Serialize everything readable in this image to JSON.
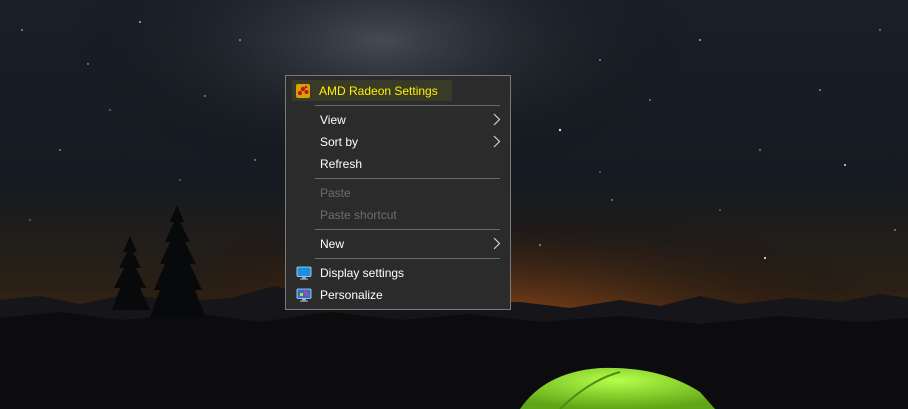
{
  "desktop": {
    "wallpaper": "night-sky-with-tent",
    "colors": {
      "sky_top": "#141922",
      "horizon": "#8a4a16",
      "tent": "#7fd12a"
    }
  },
  "context_menu": {
    "items": [
      {
        "id": "amd",
        "label": "AMD Radeon Settings",
        "icon": "amd-radeon-icon",
        "highlight": true
      },
      {
        "id": "view",
        "label": "View",
        "submenu": true
      },
      {
        "id": "sortby",
        "label": "Sort by",
        "submenu": true
      },
      {
        "id": "refresh",
        "label": "Refresh"
      },
      {
        "id": "paste",
        "label": "Paste",
        "disabled": true
      },
      {
        "id": "paste_shortcut",
        "label": "Paste shortcut",
        "disabled": true
      },
      {
        "id": "new",
        "label": "New",
        "submenu": true
      },
      {
        "id": "display",
        "label": "Display settings",
        "icon": "display-settings-icon"
      },
      {
        "id": "personalize",
        "label": "Personalize",
        "icon": "personalize-icon"
      }
    ],
    "colors": {
      "background": "#2b2b2b",
      "text": "#ffffff",
      "disabled_text": "#6d6d6d",
      "highlight_text": "#fff200"
    }
  }
}
